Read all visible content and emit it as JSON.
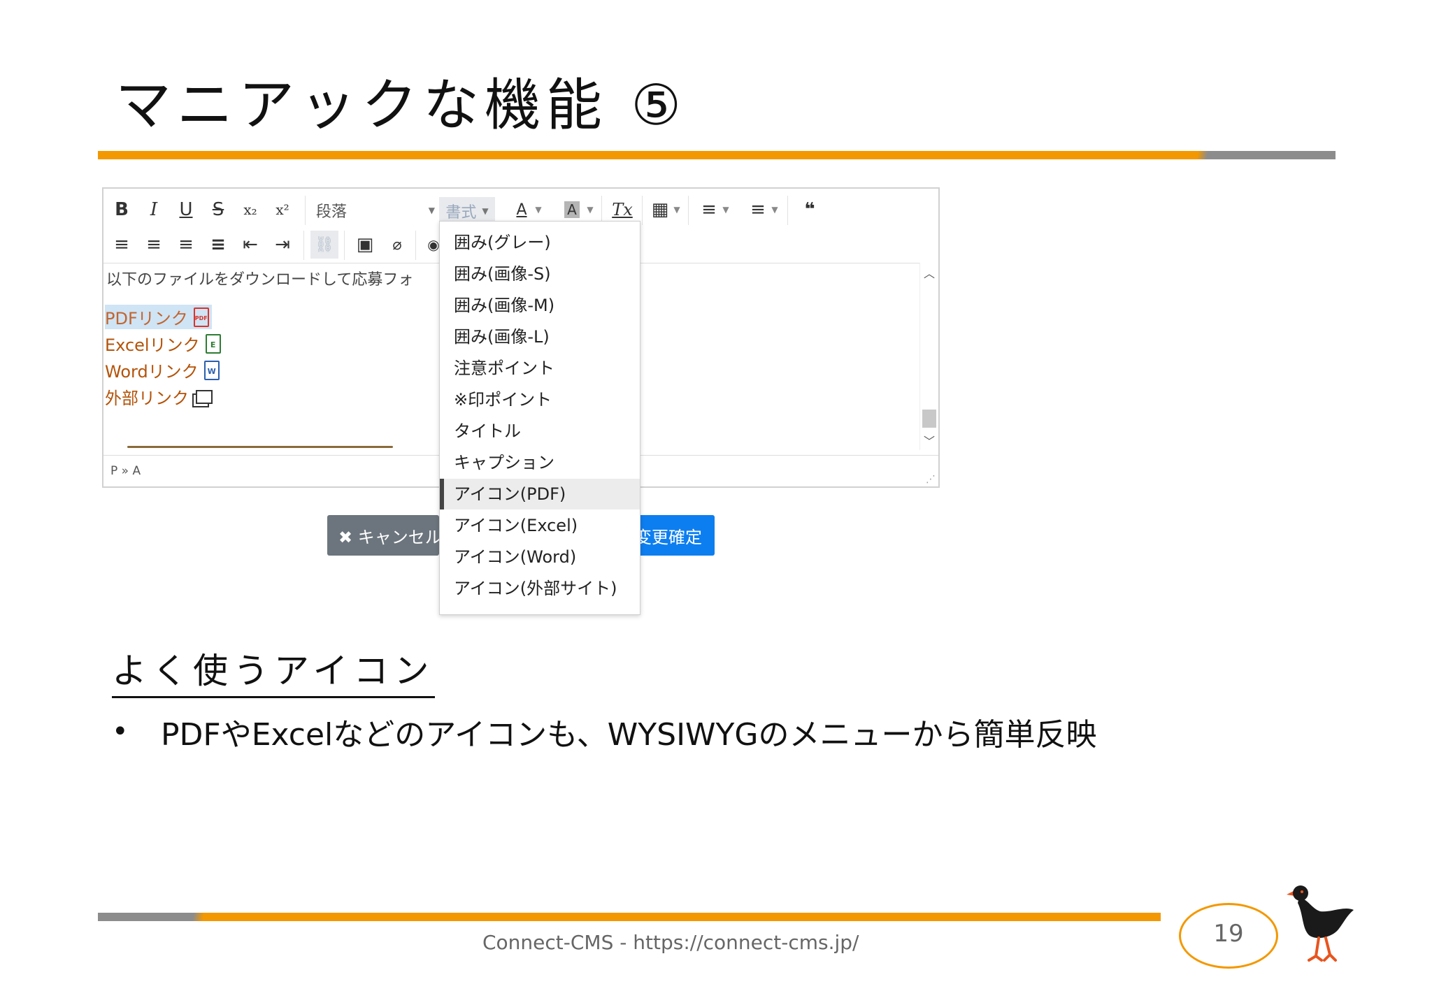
{
  "slide": {
    "title": "マニアックな機能 ⑤",
    "section_heading": "よく使うアイコン",
    "bullet": "PDFやExcelなどのアイコンも、WYSIWYGのメニューから簡単反映",
    "footer": "Connect-CMS - https://connect-cms.jp/",
    "page_number": "19"
  },
  "colors": {
    "accent": "#f39800",
    "gray_bar": "#8c8c8c",
    "confirm_blue": "#0d7ef0",
    "cancel_gray": "#6c757d",
    "link_brown": "#b45309"
  },
  "editor": {
    "toolbar_row1": [
      {
        "icon": "bold-icon",
        "glyph": "B"
      },
      {
        "icon": "italic-icon",
        "glyph": "I"
      },
      {
        "icon": "underline-icon",
        "glyph": "U"
      },
      {
        "icon": "strikethrough-icon",
        "glyph": "S"
      },
      {
        "icon": "subscript-icon",
        "glyph": "x₂"
      },
      {
        "icon": "superscript-icon",
        "glyph": "x²"
      }
    ],
    "paragraph_select": "段落",
    "format_label": "書式",
    "toolbar_row1_right": [
      {
        "icon": "text-color-icon",
        "glyph": "A"
      },
      {
        "icon": "background-color-icon",
        "glyph": "A"
      },
      {
        "icon": "clear-format-icon",
        "glyph": "Tx"
      },
      {
        "icon": "table-icon",
        "glyph": "▦"
      },
      {
        "icon": "numbered-list-icon",
        "glyph": "≡"
      },
      {
        "icon": "bullet-list-icon",
        "glyph": "≡"
      },
      {
        "icon": "blockquote-icon",
        "glyph": "❝"
      }
    ],
    "toolbar_row2": [
      {
        "icon": "align-left-icon",
        "glyph": "≡"
      },
      {
        "icon": "align-center-icon",
        "glyph": "≡"
      },
      {
        "icon": "align-right-icon",
        "glyph": "≡"
      },
      {
        "icon": "align-justify-icon",
        "glyph": "≡"
      },
      {
        "icon": "outdent-icon",
        "glyph": "⇤"
      },
      {
        "icon": "indent-icon",
        "glyph": "⇥"
      },
      {
        "icon": "link-icon",
        "glyph": "⛓"
      },
      {
        "icon": "image-icon",
        "glyph": "▣"
      },
      {
        "icon": "attachment-icon",
        "glyph": "⌀"
      },
      {
        "icon": "preview-icon",
        "glyph": "◉"
      }
    ],
    "content_text": "以下のファイルをダウンロードして応募フォ",
    "links": [
      {
        "label": "PDFリンク",
        "icon": "pdf-file-icon",
        "badge": "PDF",
        "color": "#d9342b",
        "selected": true
      },
      {
        "label": "Excelリンク",
        "icon": "excel-file-icon",
        "badge": "E",
        "color": "#2e7d32",
        "selected": false
      },
      {
        "label": "Wordリンク",
        "icon": "word-file-icon",
        "badge": "W",
        "color": "#2b5fad",
        "selected": false
      },
      {
        "label": "外部リンク",
        "icon": "external-link-icon",
        "badge": "",
        "color": "#333333",
        "selected": false
      }
    ],
    "statusbar_path": "P » A"
  },
  "dropdown": {
    "items": [
      "囲み(グレー)",
      "囲み(画像-S)",
      "囲み(画像-M)",
      "囲み(画像-L)",
      "注意ポイント",
      "※印ポイント",
      "タイトル",
      "キャプション",
      "アイコン(PDF)",
      "アイコン(Excel)",
      "アイコン(Word)",
      "アイコン(外部サイト)"
    ],
    "active_index": 8
  },
  "buttons": {
    "cancel": "✖ キャンセル",
    "confirm": "変更確定"
  }
}
